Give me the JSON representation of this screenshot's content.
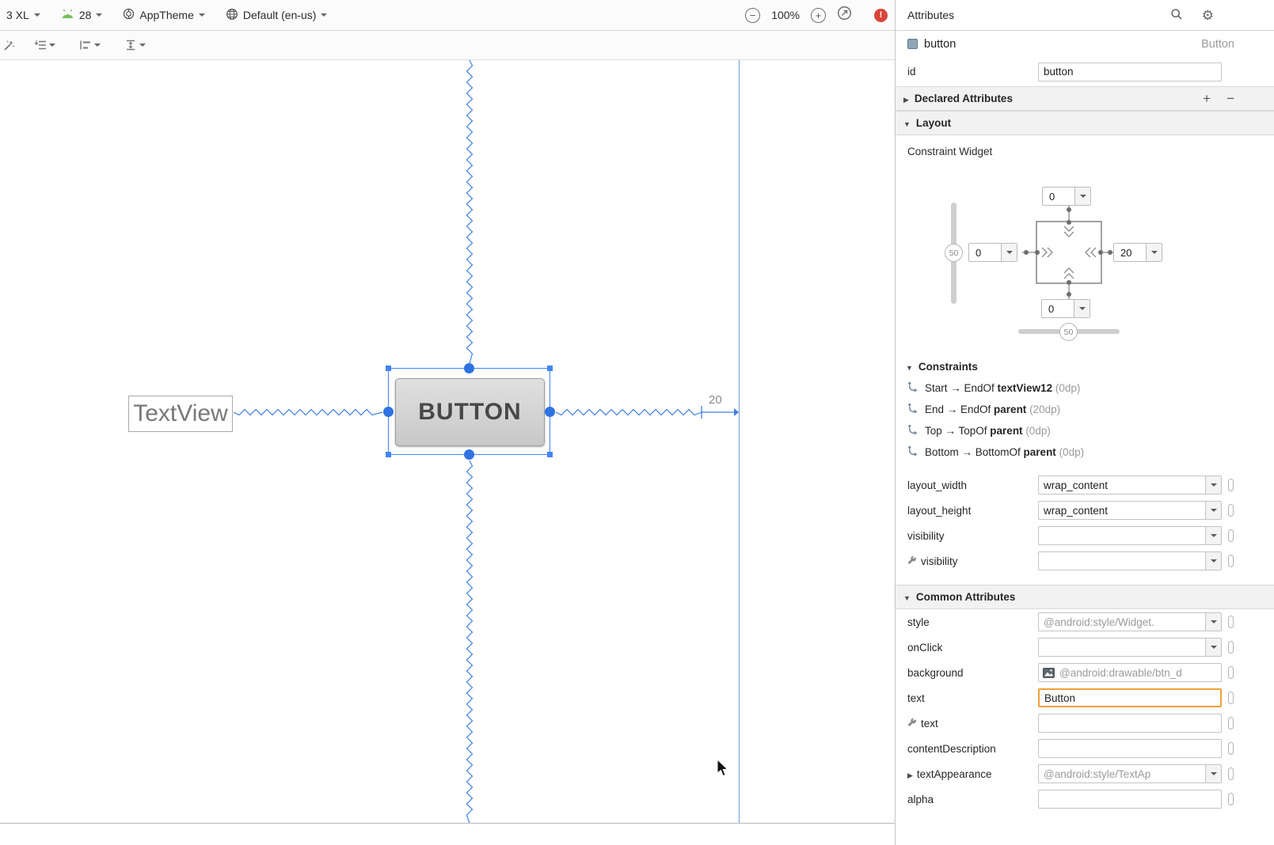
{
  "toolbar": {
    "device_label": "3 XL",
    "api_label": "28",
    "theme_label": "AppTheme",
    "locale_label": "Default (en-us)",
    "zoom_value": "100%"
  },
  "canvas": {
    "textview_text": "TextView",
    "button_text": "BUTTON",
    "margin_value": "20"
  },
  "panel": {
    "title": "Attributes",
    "component_name": "button",
    "component_class": "Button",
    "id_label": "id",
    "id_value": "button",
    "declared_header": "Declared Attributes",
    "layout_header": "Layout",
    "constraint_widget_label": "Constraint Widget",
    "margin_top": "0",
    "margin_left": "0",
    "margin_right": "20",
    "margin_bottom": "0",
    "bias_vertical": "50",
    "bias_horizontal": "50",
    "constraints_header": "Constraints",
    "constraints": [
      {
        "prefix": "Start → EndOf ",
        "target": "textView12",
        "suffix": " (0dp)"
      },
      {
        "prefix": "End → EndOf ",
        "target": "parent",
        "suffix": " (20dp)"
      },
      {
        "prefix": "Top → TopOf ",
        "target": "parent",
        "suffix": " (0dp)"
      },
      {
        "prefix": "Bottom → BottomOf ",
        "target": "parent",
        "suffix": " (0dp)"
      }
    ],
    "layout_attrs": [
      {
        "label": "layout_width",
        "value": "wrap_content"
      },
      {
        "label": "layout_height",
        "value": "wrap_content"
      },
      {
        "label": "visibility",
        "value": ""
      },
      {
        "label": "visibility",
        "value": ""
      }
    ],
    "common_header": "Common Attributes",
    "common_attrs": [
      {
        "label": "style",
        "value": "@android:style/Widget."
      },
      {
        "label": "onClick",
        "value": ""
      },
      {
        "label": "background",
        "value": "@android:drawable/btn_d"
      },
      {
        "label": "text",
        "value": "Button"
      },
      {
        "label": "text",
        "value": ""
      },
      {
        "label": "contentDescription",
        "value": ""
      },
      {
        "label": "textAppearance",
        "value": "@android:style/TextAp"
      },
      {
        "label": "alpha",
        "value": ""
      }
    ]
  },
  "icons": {
    "gear": "⚙",
    "error": "!"
  },
  "colors": {
    "selection_blue": "#4285f4",
    "constraint_blue": "#3f7fe0",
    "focus_orange": "#f0a03a",
    "error_red": "#d9453b"
  }
}
